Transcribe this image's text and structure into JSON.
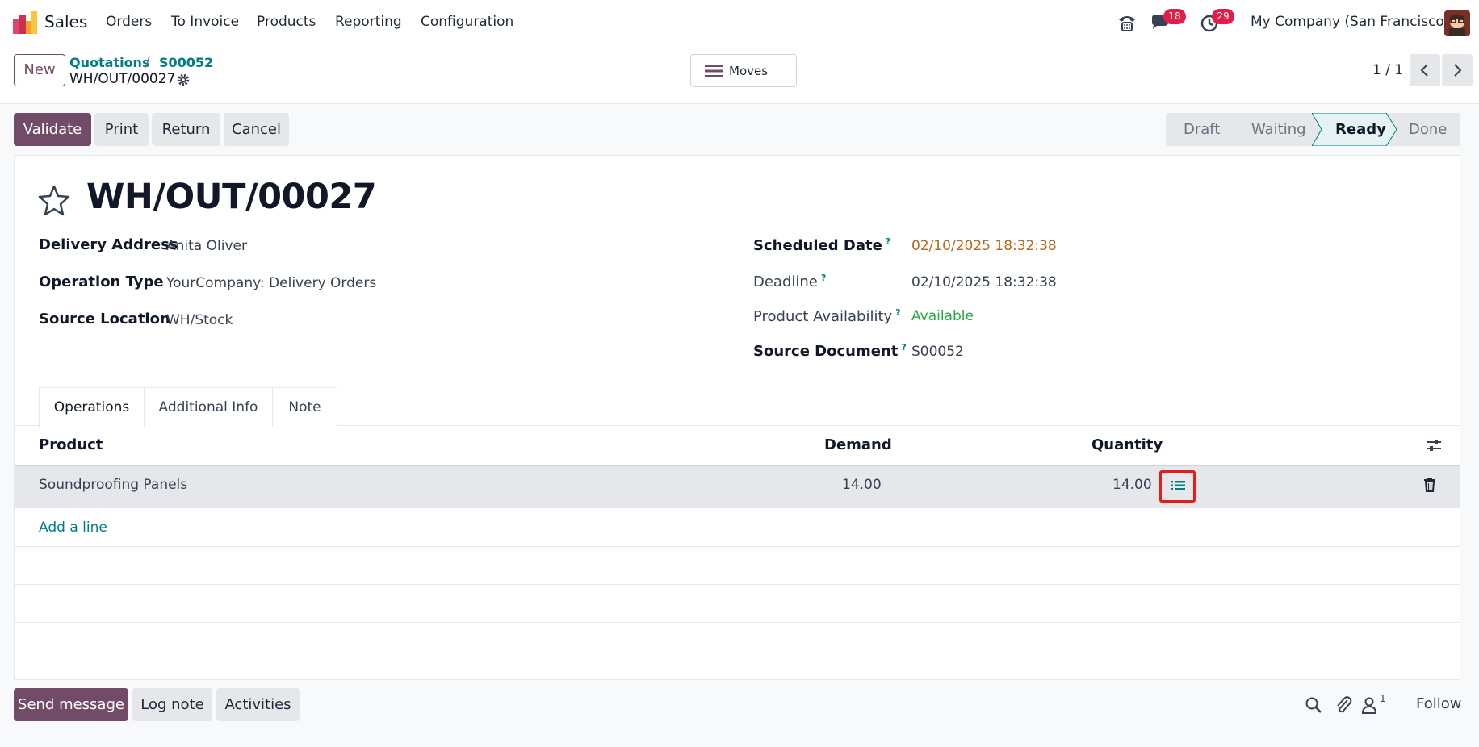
{
  "nav": {
    "app_name": "Sales",
    "menu": [
      "Orders",
      "To Invoice",
      "Products",
      "Reporting",
      "Configuration"
    ],
    "messages_count": "18",
    "activities_count": "29",
    "company": "My Company (San Francisco)"
  },
  "control": {
    "new_label": "New",
    "breadcrumb": [
      "Quotations",
      "S00052"
    ],
    "breadcrumb_sep": "/",
    "current": "WH/OUT/00027",
    "smart_button": "Moves",
    "pager": "1 / 1"
  },
  "actions": {
    "validate": "Validate",
    "print": "Print",
    "return": "Return",
    "cancel": "Cancel"
  },
  "status": {
    "stages": [
      "Draft",
      "Waiting",
      "Ready",
      "Done"
    ],
    "current": "Ready"
  },
  "record": {
    "title": "WH/OUT/00027",
    "fields_left": [
      {
        "label": "Delivery Address",
        "value": "Anita Oliver"
      },
      {
        "label": "Operation Type",
        "value": "YourCompany: Delivery Orders"
      },
      {
        "label": "Source Location",
        "value": "WH/Stock"
      }
    ],
    "fields_right": [
      {
        "label": "Scheduled Date",
        "value": "02/10/2025 18:32:38"
      },
      {
        "label": "Deadline",
        "value": "02/10/2025 18:32:38"
      },
      {
        "label": "Product Availability",
        "value": "Available"
      },
      {
        "label": "Source Document",
        "value": "S00052"
      }
    ],
    "help_mark": "?"
  },
  "colors": {
    "primary": "#714b67",
    "link": "#017e84",
    "warning_date": "#b4691d",
    "available": "#28a745",
    "highlight_box": "#e11d1d"
  },
  "tabs": [
    "Operations",
    "Additional Info",
    "Note"
  ],
  "table": {
    "headers": {
      "product": "Product",
      "demand": "Demand",
      "quantity": "Quantity"
    },
    "rows": [
      {
        "product": "Soundproofing Panels",
        "demand": "14.00",
        "quantity": "14.00"
      }
    ],
    "add_line": "Add a line"
  },
  "chatter": {
    "send_message": "Send message",
    "log_note": "Log note",
    "activities": "Activities",
    "followers_count": "1",
    "follow": "Follow"
  }
}
